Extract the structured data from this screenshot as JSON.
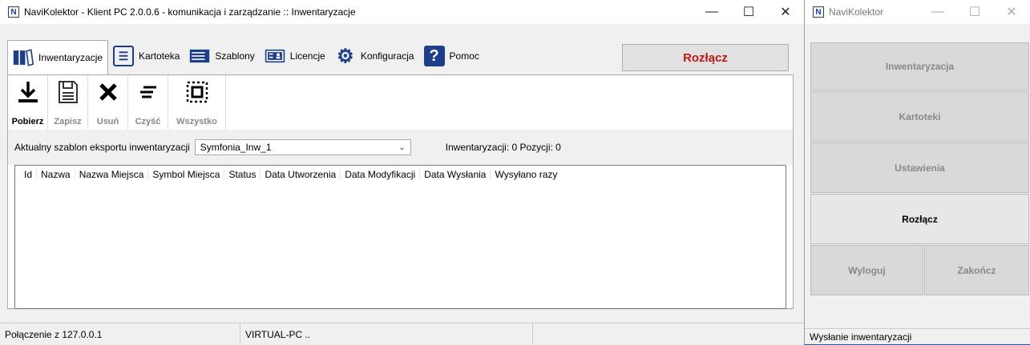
{
  "main": {
    "title": "NaviKolektor - Klient PC 2.0.0.6 - komunikacja i zarządzanie :: Inwentaryzacje",
    "app_icon": "N",
    "minimize": "—",
    "maximize": "☐",
    "close": "✕",
    "tabs": [
      {
        "label": "Inwentaryzacje",
        "icon": "folders-icon"
      },
      {
        "label": "Kartoteka",
        "icon": "list-icon"
      },
      {
        "label": "Szablony",
        "icon": "template-icon"
      },
      {
        "label": "Licencje",
        "icon": "license-icon"
      },
      {
        "label": "Konfiguracja",
        "icon": "gears-icon"
      },
      {
        "label": "Pomoc",
        "icon": "help-icon"
      }
    ],
    "disconnect_label": "Rozłącz",
    "toolbar": [
      {
        "label": "Pobierz",
        "icon": "download-icon",
        "enabled": true
      },
      {
        "label": "Zapisz",
        "icon": "save-icon",
        "enabled": false
      },
      {
        "label": "Usuń",
        "icon": "delete-icon",
        "enabled": false
      },
      {
        "label": "Czyść",
        "icon": "clear-icon",
        "enabled": false
      },
      {
        "label": "Wszystko",
        "icon": "select-all-icon",
        "enabled": false
      }
    ],
    "template_label": "Aktualny szablon eksportu inwentaryzacji",
    "template_value": "Symfonia_Inw_1",
    "counts": "Inwentaryzacji: 0 Pozycji: 0",
    "columns": [
      "Id",
      "Nazwa",
      "Nazwa Miejsca",
      "Symbol Miejsca",
      "Status",
      "Data Utworzenia",
      "Data Modyfikacji",
      "Data Wysłania",
      "Wysyłano razy"
    ],
    "status": {
      "connection": "Połączenie z 127.0.0.1",
      "host": "VIRTUAL-PC .."
    }
  },
  "side": {
    "title": "NaviKolektor",
    "buttons": {
      "inventory": "Inwentaryzacja",
      "records": "Kartoteki",
      "settings": "Ustawienia",
      "disconnect": "Rozłącz",
      "logout": "Wyloguj",
      "exit": "Zakończ"
    },
    "status": "Wysłanie inwentaryzacji"
  },
  "colors": {
    "accent": "#1d3f8a",
    "disconnect": "#c01818"
  }
}
